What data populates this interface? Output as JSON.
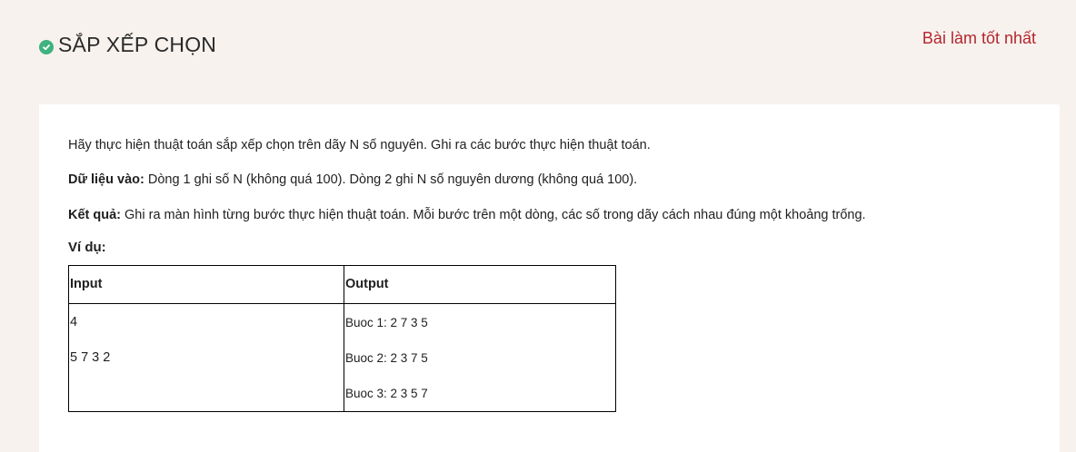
{
  "header": {
    "title": "SẮP XẾP CHỌN",
    "status_icon": "check-circle-icon",
    "best_link": "Bài làm tốt nhất"
  },
  "problem": {
    "description": "Hãy thực hiện thuật toán sắp xếp chọn trên dãy N số nguyên. Ghi ra các bước thực hiện thuật toán.",
    "input_label": "Dữ liệu vào:",
    "input_text": "Dòng 1 ghi số N (không quá 100). Dòng 2 ghi N số nguyên dương (không quá 100).",
    "output_label": "Kết quả:",
    "output_text": "Ghi ra màn hình từng bước thực hiện thuật toán. Mỗi bước trên một dòng, các số trong dãy cách nhau đúng một khoảng trống.",
    "example_label": "Ví dụ:",
    "table": {
      "headers": [
        "Input",
        "Output"
      ],
      "input_lines": [
        "4",
        "5 7 3 2"
      ],
      "output_lines": [
        "Buoc 1: 2 7 3 5",
        "Buoc 2: 2 3 7 5",
        "Buoc 3: 2 3 5 7"
      ]
    }
  },
  "colors": {
    "background": "#f7f2ee",
    "card": "#ffffff",
    "accent_link": "#b3262d",
    "check": "#3fb27f"
  }
}
